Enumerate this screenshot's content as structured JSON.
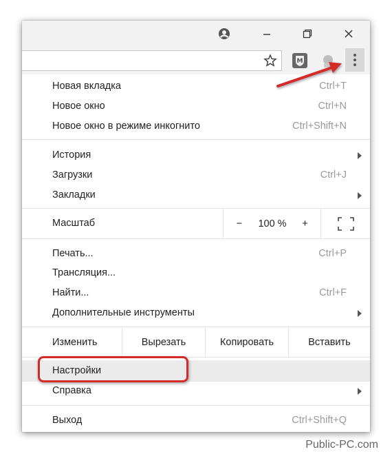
{
  "menu": {
    "section1": [
      {
        "label": "Новая вкладка",
        "shortcut": "Ctrl+T"
      },
      {
        "label": "Новое окно",
        "shortcut": "Ctrl+N"
      },
      {
        "label": "Новое окно в режиме инкогнито",
        "shortcut": "Ctrl+Shift+N"
      }
    ],
    "section2": [
      {
        "label": "История",
        "shortcut": ""
      },
      {
        "label": "Загрузки",
        "shortcut": "Ctrl+J"
      },
      {
        "label": "Закладки",
        "shortcut": ""
      }
    ],
    "zoom": {
      "label": "Масштаб",
      "minus": "−",
      "value": "100 %",
      "plus": "+"
    },
    "section3": [
      {
        "label": "Печать...",
        "shortcut": "Ctrl+P"
      },
      {
        "label": "Трансляция...",
        "shortcut": ""
      },
      {
        "label": "Найти...",
        "shortcut": "Ctrl+F"
      },
      {
        "label": "Дополнительные инструменты",
        "shortcut": ""
      }
    ],
    "edit": {
      "label": "Изменить",
      "cut": "Вырезать",
      "copy": "Копировать",
      "paste": "Вставить"
    },
    "section4": [
      {
        "label": "Настройки",
        "shortcut": ""
      },
      {
        "label": "Справка",
        "shortcut": ""
      }
    ],
    "exit": {
      "label": "Выход",
      "shortcut": "Ctrl+Shift+Q"
    }
  },
  "icons": {
    "profile": "person-icon",
    "minimize": "minimize-icon",
    "restore": "restore-icon",
    "close": "close-icon",
    "bookmark": "star-icon",
    "extension": "m-shield-icon",
    "extension2": "gray-extension-icon",
    "menu": "kebab-menu-icon"
  },
  "colors": {
    "highlight": "#d42a2a",
    "arrow": "#d42a2a"
  },
  "watermark": "Public-PC.com"
}
